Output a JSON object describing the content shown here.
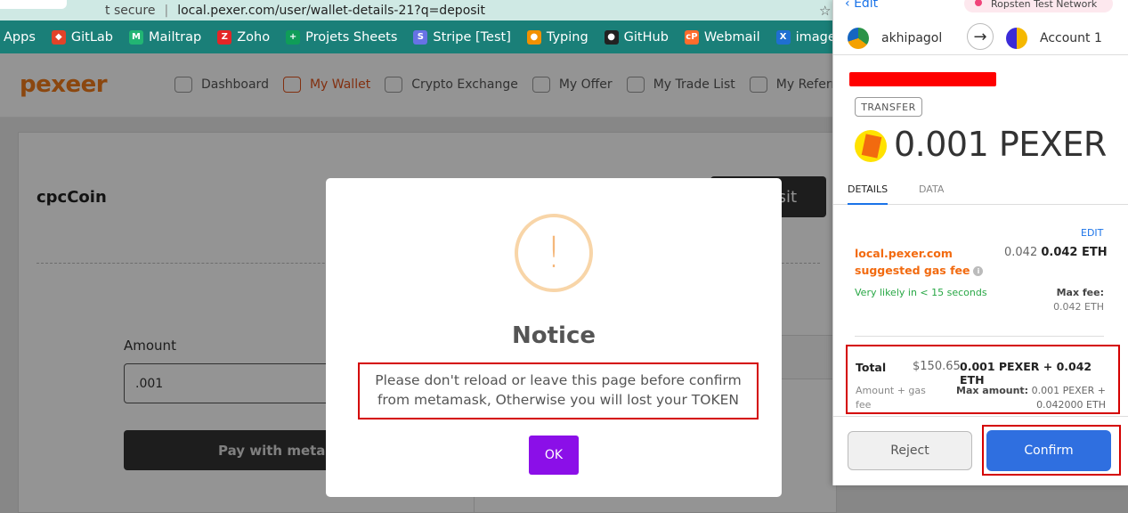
{
  "browser": {
    "secure_text": "t secure",
    "url": "local.pexer.com/user/wallet-details-21?q=deposit"
  },
  "bookmarks": [
    {
      "label": "Apps",
      "color": "#1a7f78",
      "glyph": ""
    },
    {
      "label": "GitLab",
      "color": "#e24329",
      "glyph": "◆"
    },
    {
      "label": "Mailtrap",
      "color": "#22b573",
      "glyph": "M"
    },
    {
      "label": "Zoho",
      "color": "#e42527",
      "glyph": "Z"
    },
    {
      "label": "Projets Sheets",
      "color": "#0f9d58",
      "glyph": "+"
    },
    {
      "label": "Stripe [Test]",
      "color": "#6772e5",
      "glyph": "S"
    },
    {
      "label": "Typing",
      "color": "#f29100",
      "glyph": "●"
    },
    {
      "label": "GitHub",
      "color": "#222222",
      "glyph": "●"
    },
    {
      "label": "Webmail",
      "color": "#ff6c2c",
      "glyph": "cP"
    },
    {
      "label": "image ed",
      "color": "#1f6fd1",
      "glyph": "X"
    }
  ],
  "app": {
    "logo": "pexeer",
    "nav": [
      {
        "label": "Dashboard",
        "active": false
      },
      {
        "label": "My Wallet",
        "active": true
      },
      {
        "label": "Crypto Exchange",
        "active": false
      },
      {
        "label": "My Offer",
        "active": false
      },
      {
        "label": "My Trade List",
        "active": false
      },
      {
        "label": "My Referral",
        "active": false
      }
    ],
    "coin_title": "cpcCoin",
    "deposit_label": "sit",
    "amount_label": "Amount",
    "amount_value": ".001",
    "pay_label": "Pay with metam"
  },
  "modal": {
    "icon": "!",
    "title": "Notice",
    "message_line1": "Please don't reload or leave this page before confirm",
    "message_line2": "from metamask, Otherwise you will lost your TOKEN",
    "ok_label": "OK"
  },
  "metamask": {
    "edit_label": "Edit",
    "network": "Ropsten Test Network",
    "from_account": "akhipagol",
    "to_account": "Account 1",
    "transfer_tag": "TRANSFER",
    "amount": "0.001 PEXER",
    "tabs": [
      "DETAILS",
      "DATA"
    ],
    "edit_link": "EDIT",
    "site_line1": "local.pexer.com",
    "site_line2": "suggested gas fee",
    "gas_fiat": "0.042",
    "gas_eth": "0.042 ETH",
    "likely": "Very likely in < 15 seconds",
    "max_fee_label": "Max fee:",
    "max_fee_value": "0.042 ETH",
    "total_label": "Total",
    "total_usd": "$150.65",
    "total_amount": "0.001 PEXER + 0.042 ETH",
    "total_sub_line1": "Amount + gas",
    "total_sub_line2": "fee",
    "max_amount_label": "Max amount:",
    "max_amount_line1": "0.001 PEXER +",
    "max_amount_line2": "0.042000 ETH",
    "reject_label": "Reject",
    "confirm_label": "Confirm"
  }
}
